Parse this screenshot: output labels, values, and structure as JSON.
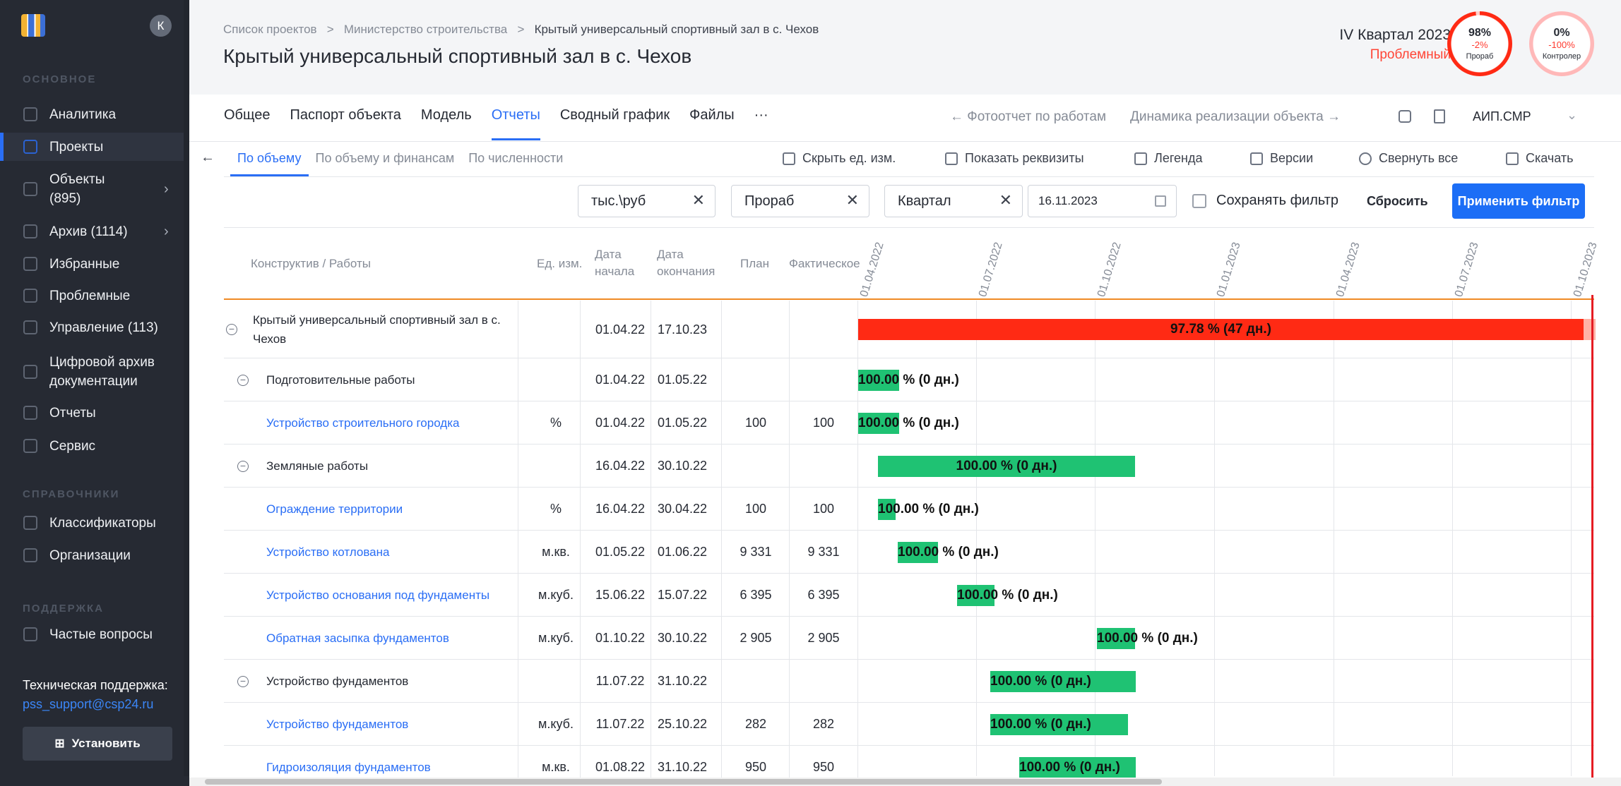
{
  "sidebar": {
    "avatar": "К",
    "sections": {
      "main": "ОСНОВНОЕ",
      "refs": "СПРАВОЧНИКИ",
      "support": "ПОДДЕРЖКА"
    },
    "items": [
      {
        "label": "Аналитика"
      },
      {
        "label": "Проекты"
      },
      {
        "label": "Объекты\n(895)"
      },
      {
        "label": "Архив (1114)"
      },
      {
        "label": "Избранные"
      },
      {
        "label": "Проблемные"
      },
      {
        "label": "Управление (113)"
      },
      {
        "label": "Цифровой архив\nдокументации"
      },
      {
        "label": "Отчеты"
      },
      {
        "label": "Сервис"
      },
      {
        "label": "Классификаторы"
      },
      {
        "label": "Организации"
      },
      {
        "label": "Частые вопросы"
      }
    ],
    "support_title": "Техническая поддержка:",
    "support_email": "pss_support@csp24.ru",
    "install_label": "Установить"
  },
  "header": {
    "breadcrumbs": [
      "Список проектов",
      "Министерство строительства",
      "Крытый универсальный спортивный зал в с. Чехов"
    ],
    "title": "Крытый универсальный спортивный зал в с. Чехов",
    "quarter": "IV Квартал 2023",
    "status": "Проблемный",
    "ring1": {
      "pct": "98%",
      "delta": "-2%",
      "name": "Прораб",
      "value": 98,
      "color": "#ff2a14"
    },
    "ring2": {
      "pct": "0%",
      "delta": "-100%",
      "name": "Контролер",
      "value": 0,
      "color": "#ff9a9a"
    }
  },
  "tabs": [
    "Общее",
    "Паспорт объекта",
    "Модель",
    "Отчеты",
    "Сводный график",
    "Файлы",
    "···"
  ],
  "report_nav": {
    "prev": "←  Фотоотчет по работам",
    "next": "Динамика реализации объекта  →",
    "select": "АИП.СМР"
  },
  "subtabs": [
    "По объему",
    "По объему и финансам",
    "По численности"
  ],
  "tools": [
    "Скрыть ед. изм.",
    "Показать реквизиты",
    "Легенда",
    "Версии",
    "Свернуть все",
    "Скачать"
  ],
  "filter": {
    "unit": "тыс.\\руб",
    "role": "Прораб",
    "period": "Квартал",
    "date": "16.11.2023",
    "save_label": "Сохранять фильтр",
    "reset": "Сбросить",
    "apply": "Применить фильтр"
  },
  "table": {
    "headers": {
      "work": "Конструктив / Работы",
      "unit": "Ед. изм.",
      "start": "Дата\nначала",
      "end": "Дата\nокончания",
      "plan": "План",
      "fact": "Фактическое"
    },
    "timeline": [
      "01.04.2022",
      "01.07.2022",
      "01.10.2022",
      "01.01.2023",
      "01.04.2023",
      "01.07.2023",
      "01.10.2023"
    ],
    "rows": [
      {
        "name": "Крытый универсальный спортивный зал в с. Чехов",
        "unit": "",
        "start": "01.04.22",
        "end": "17.10.23",
        "plan": "",
        "fact": "",
        "bar": "97.78 % (47 дн.)",
        "progress": 97.78,
        "level": 0
      },
      {
        "name": "Подготовительные работы",
        "unit": "",
        "start": "01.04.22",
        "end": "01.05.22",
        "plan": "",
        "fact": "",
        "bar": "100.00 % (0 дн.)",
        "progress": 100,
        "level": 1
      },
      {
        "name": "Устройство строительного городка",
        "unit": "%",
        "start": "01.04.22",
        "end": "01.05.22",
        "plan": "100",
        "fact": "100",
        "bar": "100.00 % (0 дн.)",
        "progress": 100,
        "level": 2
      },
      {
        "name": "Земляные работы",
        "unit": "",
        "start": "16.04.22",
        "end": "30.10.22",
        "plan": "",
        "fact": "",
        "bar": "100.00 % (0 дн.)",
        "progress": 100,
        "level": 1
      },
      {
        "name": "Ограждение территории",
        "unit": "%",
        "start": "16.04.22",
        "end": "30.04.22",
        "plan": "100",
        "fact": "100",
        "bar": "100.00 % (0 дн.)",
        "progress": 100,
        "level": 2
      },
      {
        "name": "Устройство котлована",
        "unit": "м.кв.",
        "start": "01.05.22",
        "end": "01.06.22",
        "plan": "9 331",
        "fact": "9 331",
        "bar": "100.00 % (0 дн.)",
        "progress": 100,
        "level": 2
      },
      {
        "name": "Устройство основания под фундаменты",
        "unit": "м.куб.",
        "start": "15.06.22",
        "end": "15.07.22",
        "plan": "6 395",
        "fact": "6 395",
        "bar": "100.00 % (0 дн.)",
        "progress": 100,
        "level": 2
      },
      {
        "name": "Обратная засыпка фундаментов",
        "unit": "м.куб.",
        "start": "01.10.22",
        "end": "30.10.22",
        "plan": "2 905",
        "fact": "2 905",
        "bar": "100.00 % (0 дн.)",
        "progress": 100,
        "level": 2
      },
      {
        "name": "Устройство фундаментов",
        "unit": "",
        "start": "11.07.22",
        "end": "31.10.22",
        "plan": "",
        "fact": "",
        "bar": "100.00 % (0 дн.)",
        "progress": 100,
        "level": 1
      },
      {
        "name": "Устройство фундаментов",
        "unit": "м.куб.",
        "start": "11.07.22",
        "end": "25.10.22",
        "plan": "282",
        "fact": "282",
        "bar": "100.00 % (0 дн.)",
        "progress": 100,
        "level": 2
      },
      {
        "name": "Гидроизоляция фундаментов",
        "unit": "м.кв.",
        "start": "01.08.22",
        "end": "31.10.22",
        "plan": "950",
        "fact": "950",
        "bar": "100.00 % (0 дн.)",
        "progress": 100,
        "level": 2
      }
    ]
  },
  "colors": {
    "accent": "#2a6ef5",
    "danger": "#ff2a14",
    "success": "#1fc273"
  }
}
